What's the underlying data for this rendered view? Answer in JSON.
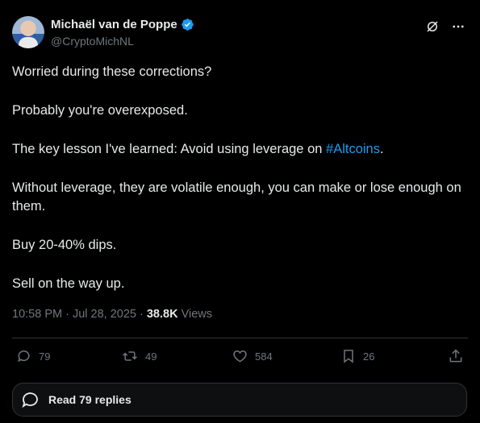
{
  "author": {
    "name": "Michaël van de Poppe",
    "handle": "@CryptoMichNL",
    "verified": true
  },
  "tweet": {
    "line1": "Worried during these corrections?",
    "line2": "Probably you're overexposed.",
    "line3_before": "The key lesson I've learned: Avoid using leverage on ",
    "line3_hashtag": "#Altcoins",
    "line3_after": ".",
    "line4": "Without leverage, they are volatile enough, you can make or lose enough on them.",
    "line5": "Buy 20-40% dips.",
    "line6": "Sell on the way up."
  },
  "meta": {
    "timestamp": "10:58 PM · Jul 28, 2025",
    "separator": " · ",
    "views_count": "38.8K",
    "views_label": " Views"
  },
  "actions": {
    "replies": "79",
    "reposts": "49",
    "likes": "584",
    "bookmarks": "26"
  },
  "read_replies": "Read 79 replies",
  "colors": {
    "background": "#000000",
    "text": "#e7e9ea",
    "muted": "#71767b",
    "accent": "#1d9bf0",
    "divider": "#2f3336"
  },
  "icons": [
    "grok-icon",
    "more-icon",
    "reply-icon",
    "repost-icon",
    "like-icon",
    "bookmark-icon",
    "share-icon",
    "replies-bubble-icon",
    "verified-badge-icon"
  ]
}
